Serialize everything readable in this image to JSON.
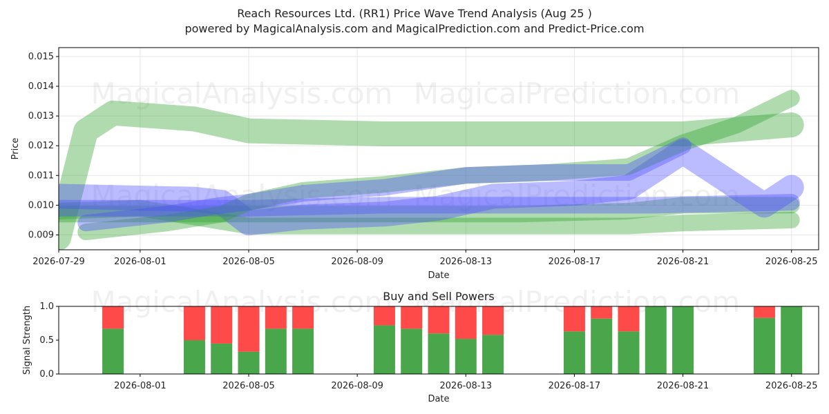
{
  "title": "Reach Resources Ltd. (RR1) Price Wave Trend Analysis (Aug 25 )",
  "subtitle": "powered by MagicalAnalysis.com and MagicalPrediction.com and Predict-Price.com",
  "watermarks": [
    "MagicalAnalysis.com",
    "MagicalPrediction.com"
  ],
  "colors": {
    "green": "#4aa64a",
    "band_green": "#2ca02c",
    "band_blue": "#4d4dff",
    "buy": "#4aa64a",
    "sell": "#ff4a4a"
  },
  "chart_data": [
    {
      "type": "area",
      "title": "",
      "xlabel": "Date",
      "ylabel": "Price",
      "xlim": [
        "2026-07-29",
        "2026-08-26"
      ],
      "ylim": [
        0.0085,
        0.0153
      ],
      "x_ticks": [
        "2026-07-29",
        "2026-08-01",
        "2026-08-05",
        "2026-08-09",
        "2026-08-13",
        "2026-08-17",
        "2026-08-21",
        "2026-08-25"
      ],
      "y_ticks": [
        "0.009",
        "0.010",
        "0.011",
        "0.012",
        "0.013",
        "0.014",
        "0.015"
      ],
      "grid": true,
      "series": [
        {
          "color": "green",
          "x": [
            "2026-07-29",
            "2026-07-30",
            "2026-07-31",
            "2026-08-03",
            "2026-08-05",
            "2026-08-10",
            "2026-08-15",
            "2026-08-19",
            "2026-08-21",
            "2026-08-25"
          ],
          "values": [
            0.0089,
            0.0125,
            0.0131,
            0.0129,
            0.0125,
            0.0124,
            0.0124,
            0.0124,
            0.0124,
            0.0127
          ]
        },
        {
          "color": "green",
          "x": [
            "2026-07-29",
            "2026-07-30",
            "2026-08-03",
            "2026-08-05",
            "2026-08-10",
            "2026-08-15",
            "2026-08-19",
            "2026-08-21",
            "2026-08-25"
          ],
          "values": [
            0.0097,
            0.0097,
            0.0097,
            0.0097,
            0.0097,
            0.0097,
            0.0098,
            0.01,
            0.01
          ]
        },
        {
          "color": "green",
          "x": [
            "2026-07-29",
            "2026-08-01",
            "2026-08-05",
            "2026-08-10",
            "2026-08-15",
            "2026-08-19",
            "2026-08-21",
            "2026-08-25"
          ],
          "values": [
            0.0098,
            0.0099,
            0.0093,
            0.0093,
            0.0093,
            0.0093,
            0.0094,
            0.0095
          ]
        },
        {
          "color": "blue",
          "x": [
            "2026-07-29",
            "2026-08-03",
            "2026-08-04",
            "2026-08-05",
            "2026-08-07",
            "2026-08-10",
            "2026-08-12",
            "2026-08-14",
            "2026-08-17",
            "2026-08-19",
            "2026-08-21",
            "2026-08-24",
            "2026-08-25"
          ],
          "values": [
            0.0103,
            0.0102,
            0.0101,
            0.0094,
            0.0096,
            0.0097,
            0.0099,
            0.0103,
            0.0104,
            0.0106,
            0.0118,
            0.01,
            0.0106
          ]
        },
        {
          "color": "blue",
          "x": [
            "2026-07-29",
            "2026-08-05",
            "2026-08-10",
            "2026-08-15",
            "2026-08-20",
            "2026-08-25"
          ],
          "values": [
            0.0099,
            0.0099,
            0.01,
            0.01,
            0.01,
            0.0101
          ]
        },
        {
          "color": "green",
          "x": [
            "2026-07-30",
            "2026-08-02",
            "2026-08-04",
            "2026-08-05",
            "2026-08-07",
            "2026-08-10",
            "2026-08-13",
            "2026-08-16",
            "2026-08-19",
            "2026-08-21",
            "2026-08-23",
            "2026-08-25"
          ],
          "values": [
            0.0091,
            0.0094,
            0.0097,
            0.0101,
            0.0105,
            0.0107,
            0.011,
            0.0111,
            0.0113,
            0.0121,
            0.0127,
            0.0136
          ]
        },
        {
          "color": "blue",
          "x": [
            "2026-07-30",
            "2026-08-02",
            "2026-08-04",
            "2026-08-05",
            "2026-08-07",
            "2026-08-10",
            "2026-08-13",
            "2026-08-16",
            "2026-08-19",
            "2026-08-21"
          ],
          "values": [
            0.0094,
            0.0097,
            0.01,
            0.0101,
            0.0104,
            0.0106,
            0.011,
            0.0111,
            0.0111,
            0.012
          ]
        }
      ]
    },
    {
      "type": "bar",
      "title": "Buy and Sell Powers",
      "xlabel": "Date",
      "ylabel": "Signal Strength",
      "ylim": [
        0,
        1
      ],
      "y_ticks": [
        "0.0",
        "0.5",
        "1.0"
      ],
      "x_ticks": [
        "2026-08-01",
        "2026-08-05",
        "2026-08-09",
        "2026-08-13",
        "2026-08-17",
        "2026-08-21",
        "2026-08-25"
      ],
      "categories": [
        "2026-07-31",
        "2026-08-03",
        "2026-08-04",
        "2026-08-05",
        "2026-08-06",
        "2026-08-07",
        "2026-08-10",
        "2026-08-11",
        "2026-08-12",
        "2026-08-13",
        "2026-08-14",
        "2026-08-17",
        "2026-08-18",
        "2026-08-19",
        "2026-08-20",
        "2026-08-21",
        "2026-08-24",
        "2026-08-25"
      ],
      "series": [
        {
          "name": "",
          "color": "buy",
          "values": [
            0.67,
            0.5,
            0.45,
            0.33,
            0.67,
            0.67,
            0.72,
            0.67,
            0.6,
            0.52,
            0.58,
            0.63,
            0.82,
            0.63,
            1.0,
            1.0,
            0.83,
            1.0
          ]
        },
        {
          "name": "",
          "color": "sell",
          "values": [
            0.33,
            0.5,
            0.55,
            0.67,
            0.33,
            0.33,
            0.28,
            0.33,
            0.4,
            0.48,
            0.42,
            0.37,
            0.18,
            0.37,
            0.0,
            0.0,
            0.17,
            0.0
          ]
        }
      ]
    }
  ]
}
